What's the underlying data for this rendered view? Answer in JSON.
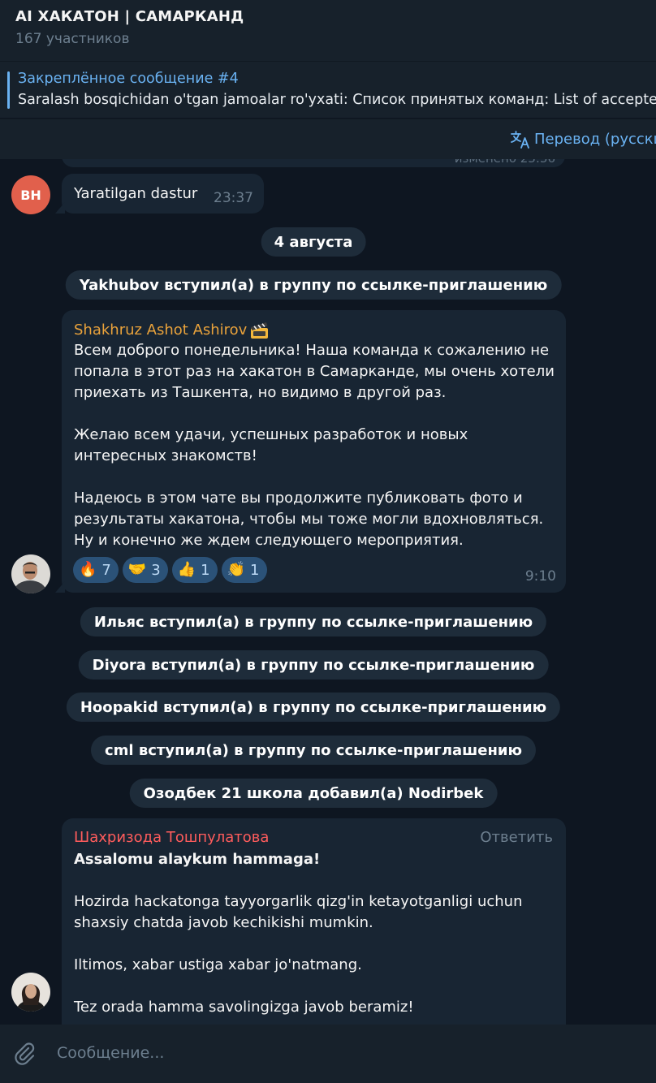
{
  "header": {
    "title": "AI ХАКАТОН | САМАРКАНД",
    "subtitle": "167 участников"
  },
  "pinned": {
    "title": "Закреплённое сообщение #4",
    "text": "Saralash bosqichidan o'tgan jamoalar ro'yxati: Список принятых команд: List of accepted"
  },
  "translate": {
    "label": "Перевод (русский)",
    "icon": "translate-icon"
  },
  "partial": {
    "edited": "изменено 23:36"
  },
  "messages": [
    {
      "avatar_initials": "BH",
      "avatar_color": "#e1604c",
      "text": "Yaratilgan dastur",
      "time": "23:37"
    },
    {
      "sender": "Shakhruz Ashot Ashirov",
      "sender_color": "#e9a23b",
      "badge_icon": "clapperboard-icon",
      "text": "Всем доброго понедельника! Наша команда к сожалению не попала в этот раз на хакатон в Самарканде, мы очень хотели приехать из Ташкента, но видимо в другой раз.\n\nЖелаю всем удачи, успешных разработок и новых интересных знакомств!\n\nНадеюсь в этом чате вы продолжите публиковать фото и результаты хакатона, чтобы мы тоже могли вдохновляться. Ну и конечно же ждем следующего мероприятия.",
      "time": "9:10",
      "reactions": [
        {
          "emoji": "🔥",
          "count": "7"
        },
        {
          "emoji": "🤝",
          "count": "3"
        },
        {
          "emoji": "👍",
          "count": "1"
        },
        {
          "emoji": "👏",
          "count": "1"
        }
      ]
    },
    {
      "sender": "Шахризода Тошпулатова",
      "sender_color": "#ff5c5c",
      "reply_label": "Ответить",
      "text_bold": "Assalomu alaykum hammaga!",
      "text": "Hozirda hackatonga tayyorgarlik qizg'in ketayotganligi uchun shaxsiy chatda javob kechikishi mumkin.\n\nIltimos, xabar ustiga xabar jo'natmang.\n\nTez orada hamma savolingizga javob beramiz!"
    }
  ],
  "service": {
    "date": "4 августа",
    "joined_yakhubov": "Yakhubov вступил(а) в группу по ссылке-приглашению",
    "joined_ilyas": "Ильяс вступил(а) в группу по ссылке-приглашению",
    "joined_diyora": "Diyora вступил(а) в группу по ссылке-приглашению",
    "joined_hoopakid": "Hoopakid вступил(а) в группу по ссылке-приглашению",
    "joined_cml": "cml вступил(а) в группу по ссылке-приглашению",
    "added": "Озодбек 21 школа добавил(а) Nodirbek"
  },
  "input": {
    "placeholder": "Сообщение..."
  }
}
